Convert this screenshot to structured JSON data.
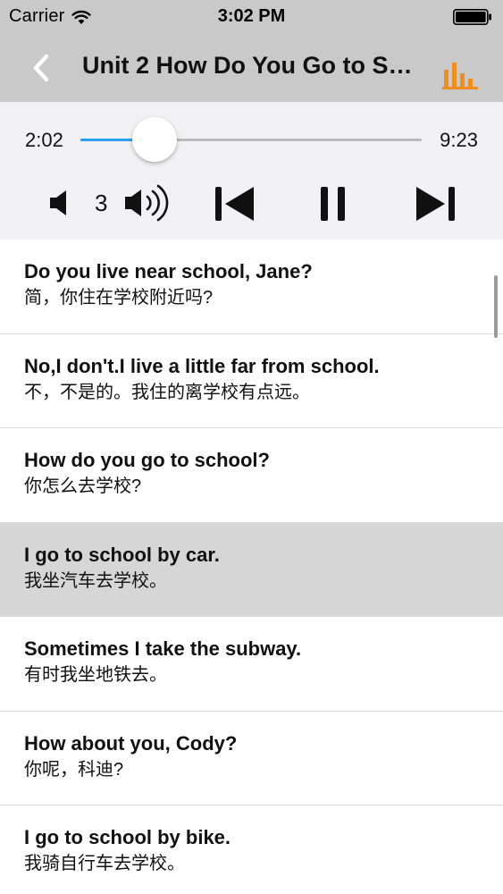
{
  "status_bar": {
    "carrier": "Carrier",
    "time": "3:02 PM"
  },
  "nav": {
    "title": "Unit 2 How Do You Go to School?",
    "back_icon": "chevron-left-icon",
    "stats_icon": "bar-chart-icon",
    "accent_color": "#f28c1b"
  },
  "player": {
    "current_time": "2:02",
    "total_time": "9:23",
    "progress": 0.2166,
    "volume": "3",
    "progress_color": "#2a9ff0"
  },
  "sentences": [
    {
      "en": "Do you live near school, Jane?",
      "zh": "简，你住在学校附近吗?"
    },
    {
      "en": "No,I don't.I live a little far from school.",
      "zh": "不，不是的。我住的离学校有点远。"
    },
    {
      "en": "How do you go to school?",
      "zh": "你怎么去学校?"
    },
    {
      "en": "I go to school by car.",
      "zh": "我坐汽车去学校。"
    },
    {
      "en": "Sometimes I take the subway.",
      "zh": "有时我坐地铁去。"
    },
    {
      "en": "How about you, Cody?",
      "zh": "你呢，科迪?"
    },
    {
      "en": "I go to school by bike.",
      "zh": "我骑自行车去学校。"
    }
  ],
  "selected_index": 3
}
